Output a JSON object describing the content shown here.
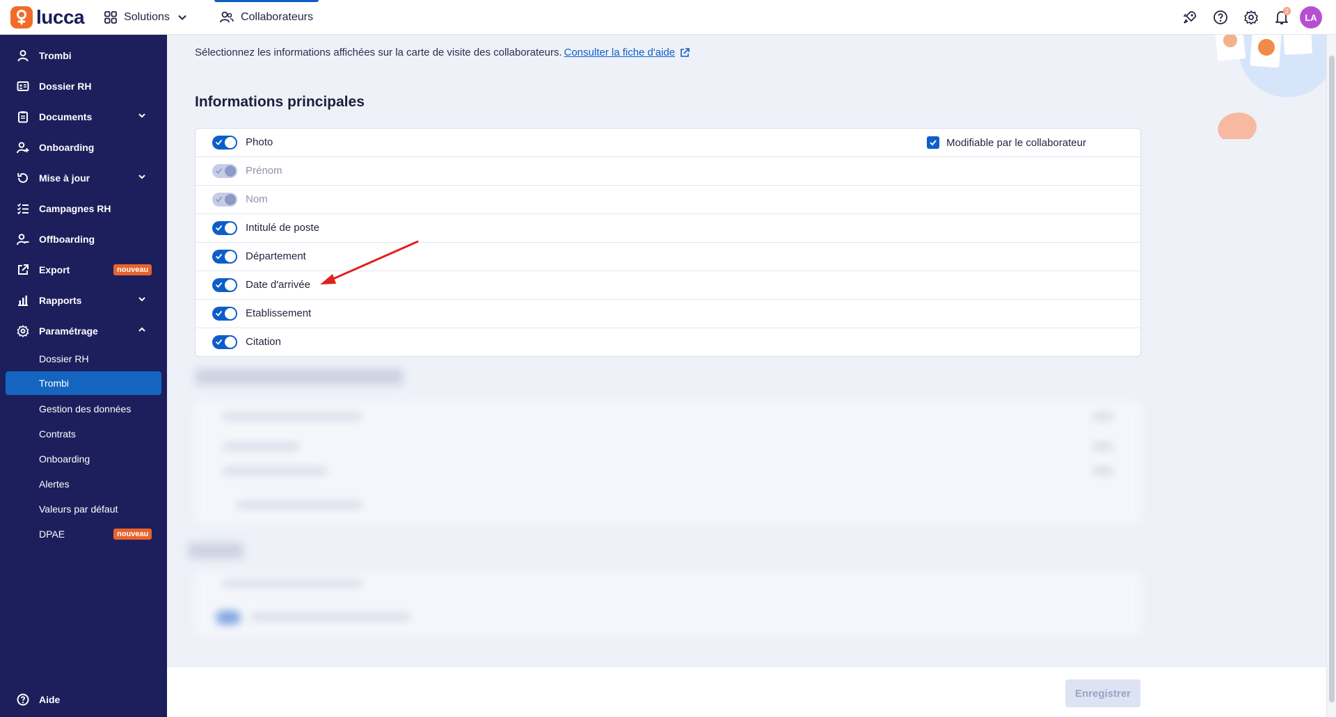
{
  "topbar": {
    "logo_text": "lucca",
    "solutions_label": "Solutions",
    "collaborateurs_label": "Collaborateurs",
    "notification_count": "2",
    "avatar_initials": "LA"
  },
  "sidebar": {
    "items": [
      {
        "label": "Trombi",
        "icon": "user-icon"
      },
      {
        "label": "Dossier RH",
        "icon": "id-card-icon"
      },
      {
        "label": "Documents",
        "icon": "clipboard-icon",
        "has_chevron": true
      },
      {
        "label": "Onboarding",
        "icon": "user-plus-icon"
      },
      {
        "label": "Mise à jour",
        "icon": "refresh-icon",
        "has_chevron": true
      },
      {
        "label": "Campagnes RH",
        "icon": "checklist-icon"
      },
      {
        "label": "Offboarding",
        "icon": "user-minus-icon"
      },
      {
        "label": "Export",
        "icon": "external-link-icon",
        "badge": "nouveau"
      },
      {
        "label": "Rapports",
        "icon": "bar-chart-icon",
        "has_chevron": true
      },
      {
        "label": "Paramétrage",
        "icon": "gear-icon",
        "expanded": true
      }
    ],
    "sub_items": [
      {
        "label": "Dossier RH"
      },
      {
        "label": "Trombi",
        "active": true
      },
      {
        "label": "Gestion des données"
      },
      {
        "label": "Contrats"
      },
      {
        "label": "Onboarding"
      },
      {
        "label": "Alertes"
      },
      {
        "label": "Valeurs par défaut"
      },
      {
        "label": "DPAE",
        "badge": "nouveau"
      }
    ],
    "help_label": "Aide"
  },
  "main": {
    "intro_text": "Sélectionnez les informations affichées sur la carte de visite des collaborateurs.",
    "help_link": "Consulter la fiche d'aide",
    "section_title": "Informations principales",
    "editable_label": "Modifiable par le collaborateur",
    "rows": [
      {
        "label": "Photo",
        "enabled": true,
        "locked": false
      },
      {
        "label": "Prénom",
        "enabled": true,
        "locked": true
      },
      {
        "label": "Nom",
        "enabled": true,
        "locked": true
      },
      {
        "label": "Intitulé de poste",
        "enabled": true,
        "locked": false
      },
      {
        "label": "Département",
        "enabled": true,
        "locked": false
      },
      {
        "label": "Date d'arrivée",
        "enabled": true,
        "locked": false
      },
      {
        "label": "Etablissement",
        "enabled": true,
        "locked": false
      },
      {
        "label": "Citation",
        "enabled": true,
        "locked": false
      }
    ]
  },
  "footer": {
    "save_label": "Enregistrer"
  },
  "colors": {
    "sidebar_bg": "#1c1f5c",
    "accent": "#0d5ec9",
    "badge_orange": "#e8632c",
    "annotation_arrow": "#e02020"
  }
}
